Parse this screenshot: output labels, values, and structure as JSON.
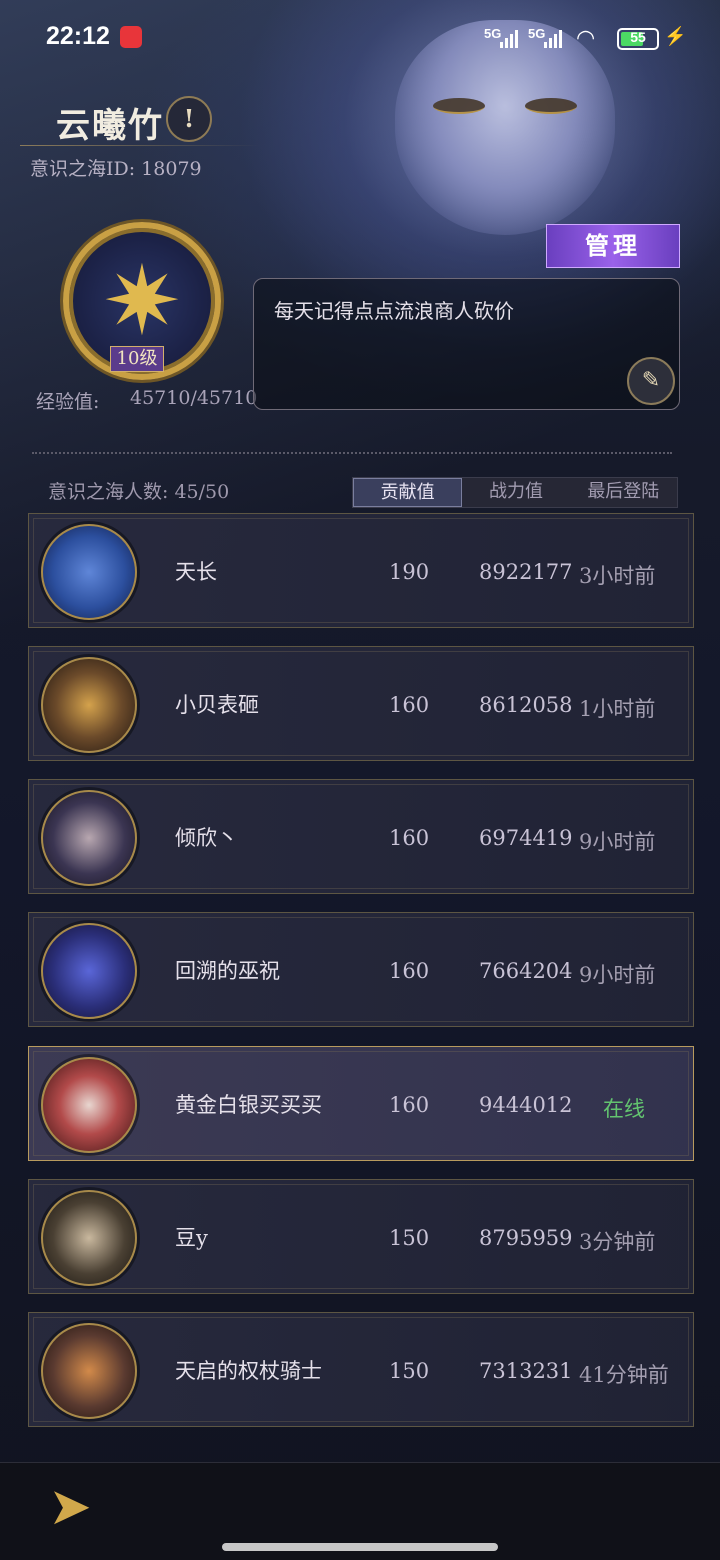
{
  "status_bar": {
    "time": "22:12",
    "network1": "5G",
    "network2": "5G",
    "battery": "55",
    "charging": "bolt-icon"
  },
  "header": {
    "title": "云曦竹",
    "id_text": "意识之海ID: 18079",
    "level": "10级",
    "exp_label": "经验值:",
    "exp_value": "45710/45710",
    "manage_label": "管理",
    "notice": "每天记得点点流浪商人砍价"
  },
  "members": {
    "count_text": "意识之海人数: 45/50",
    "tabs": [
      {
        "label": "贡献值",
        "active": true
      },
      {
        "label": "战力值",
        "active": false
      },
      {
        "label": "最后登陆",
        "active": false
      }
    ],
    "rows": [
      {
        "name": "天长",
        "contribution": "190",
        "power": "8922177",
        "last_login": "3小时前",
        "avatar_color": "#2c4f9e"
      },
      {
        "name": "小贝表砸",
        "contribution": "160",
        "power": "8612058",
        "last_login": "1小时前",
        "avatar_color": "#6b4a2a"
      },
      {
        "name": "倾欣丶",
        "contribution": "160",
        "power": "6974419",
        "last_login": "9小时前",
        "avatar_color": "#3b3552"
      },
      {
        "name": "回溯的巫祝",
        "contribution": "160",
        "power": "7664204",
        "last_login": "9小时前",
        "avatar_color": "#2b2f7a"
      },
      {
        "name": "黄金白银买买买",
        "contribution": "160",
        "power": "9444012",
        "last_login": "在线",
        "avatar_color": "#6a2a2a"
      },
      {
        "name": "豆y",
        "contribution": "150",
        "power": "8795959",
        "last_login": "3分钟前",
        "avatar_color": "#4a4033"
      },
      {
        "name": "天启的权杖骑士",
        "contribution": "150",
        "power": "7313231",
        "last_login": "41分钟前",
        "avatar_color": "#5a3a30"
      }
    ]
  }
}
